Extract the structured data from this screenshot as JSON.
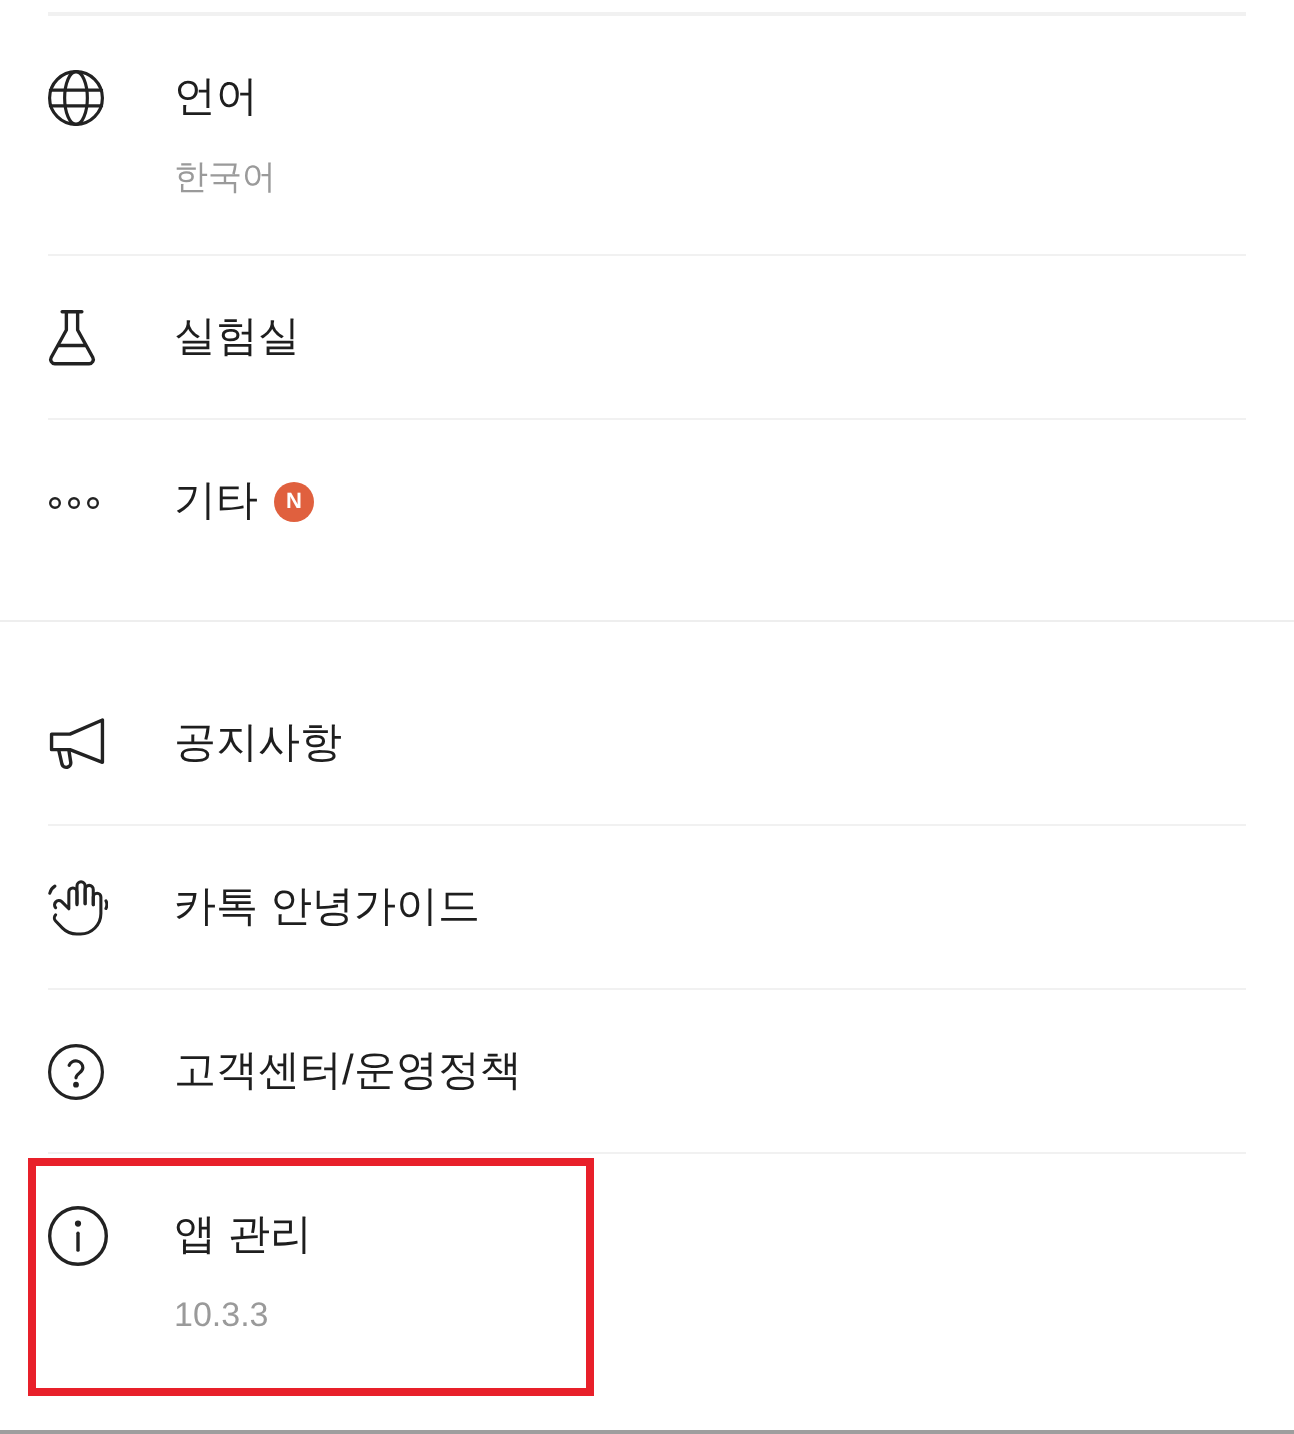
{
  "sections": [
    {
      "items": [
        {
          "title": "언어",
          "subtitle": "한국어",
          "highlighted": false
        },
        {
          "title": "실험실",
          "highlighted": false
        },
        {
          "title": "기타",
          "badge": "N",
          "highlighted": false
        }
      ]
    },
    {
      "items": [
        {
          "title": "공지사항",
          "highlighted": false
        },
        {
          "title": "카톡 안녕가이드",
          "highlighted": false
        },
        {
          "title": "고객센터/운영정책",
          "highlighted": false
        },
        {
          "title": "앱 관리",
          "subtitle": "10.3.3",
          "highlighted": true
        }
      ]
    }
  ]
}
